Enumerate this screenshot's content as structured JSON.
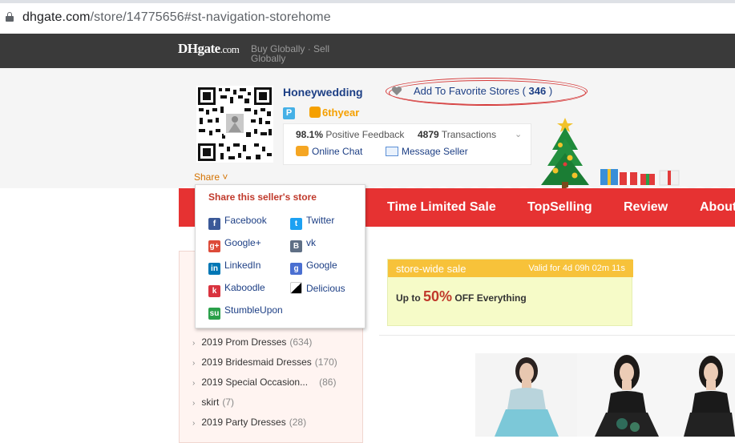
{
  "browser": {
    "url_domain": "dhgate.com",
    "url_path": "/store/14775656#st-navigation-storehome"
  },
  "site": {
    "logo_main": "DHgate",
    "logo_suffix": ".com",
    "tagline": "Buy Globally · Sell Globally"
  },
  "store": {
    "name": "Honeywedding",
    "badge": "P",
    "years": "6thyear",
    "favorite_label": "Add To Favorite Stores ( ",
    "favorite_count": "346",
    "favorite_close": " )",
    "feedback_pct": "98.1%",
    "feedback_label": "Positive Feedback",
    "transactions": "4879",
    "transactions_label": "Transactions",
    "online_chat": "Online Chat",
    "message_seller": "Message Seller",
    "share_label": "Share"
  },
  "nav": {
    "items": [
      "Time Limited Sale",
      "TopSelling",
      "Review",
      "About"
    ]
  },
  "share_menu": {
    "title": "Share this seller's store",
    "items": [
      {
        "label": "Facebook",
        "icon": "facebook-icon",
        "color": "#3b5998",
        "glyph": "f"
      },
      {
        "label": "Twitter",
        "icon": "twitter-icon",
        "color": "#1da1f2",
        "glyph": "t"
      },
      {
        "label": "Google+",
        "icon": "google-plus-icon",
        "color": "#dd4b39",
        "glyph": "g+"
      },
      {
        "label": "vk",
        "icon": "vk-icon",
        "color": "#5f6f85",
        "glyph": "B"
      },
      {
        "label": "LinkedIn",
        "icon": "linkedin-icon",
        "color": "#0077b5",
        "glyph": "in"
      },
      {
        "label": "Google",
        "icon": "google-icon",
        "color": "#4a6fd1",
        "glyph": "g"
      },
      {
        "label": "Kaboodle",
        "icon": "kaboodle-icon",
        "color": "#d9333f",
        "glyph": "k"
      },
      {
        "label": "Delicious",
        "icon": "delicious-icon",
        "color": "#3274d1",
        "glyph": ""
      },
      {
        "label": "StumbleUpon",
        "icon": "stumbleupon-icon",
        "color": "#2aa04a",
        "glyph": "su"
      }
    ]
  },
  "categories": [
    {
      "label": "2019 Prom Dresses",
      "count": "(634)"
    },
    {
      "label": "2019 Bridesmaid Dresses",
      "count": "(170)"
    },
    {
      "label": "2019 Special Occasion...",
      "count": "(86)"
    },
    {
      "label": "skirt",
      "count": "(7)"
    },
    {
      "label": "2019 Party Dresses",
      "count": "(28)"
    }
  ],
  "promo": {
    "header": "store-wide sale",
    "countdown": "Valid for 4d 09h 02m 11s",
    "line_prefix": "Up to ",
    "percent": "50%",
    "line_suffix": " OFF Everything"
  },
  "colors": {
    "accent_red": "#e63232",
    "link_blue": "#1d3f85",
    "promo_yellow": "#f7c23a"
  }
}
